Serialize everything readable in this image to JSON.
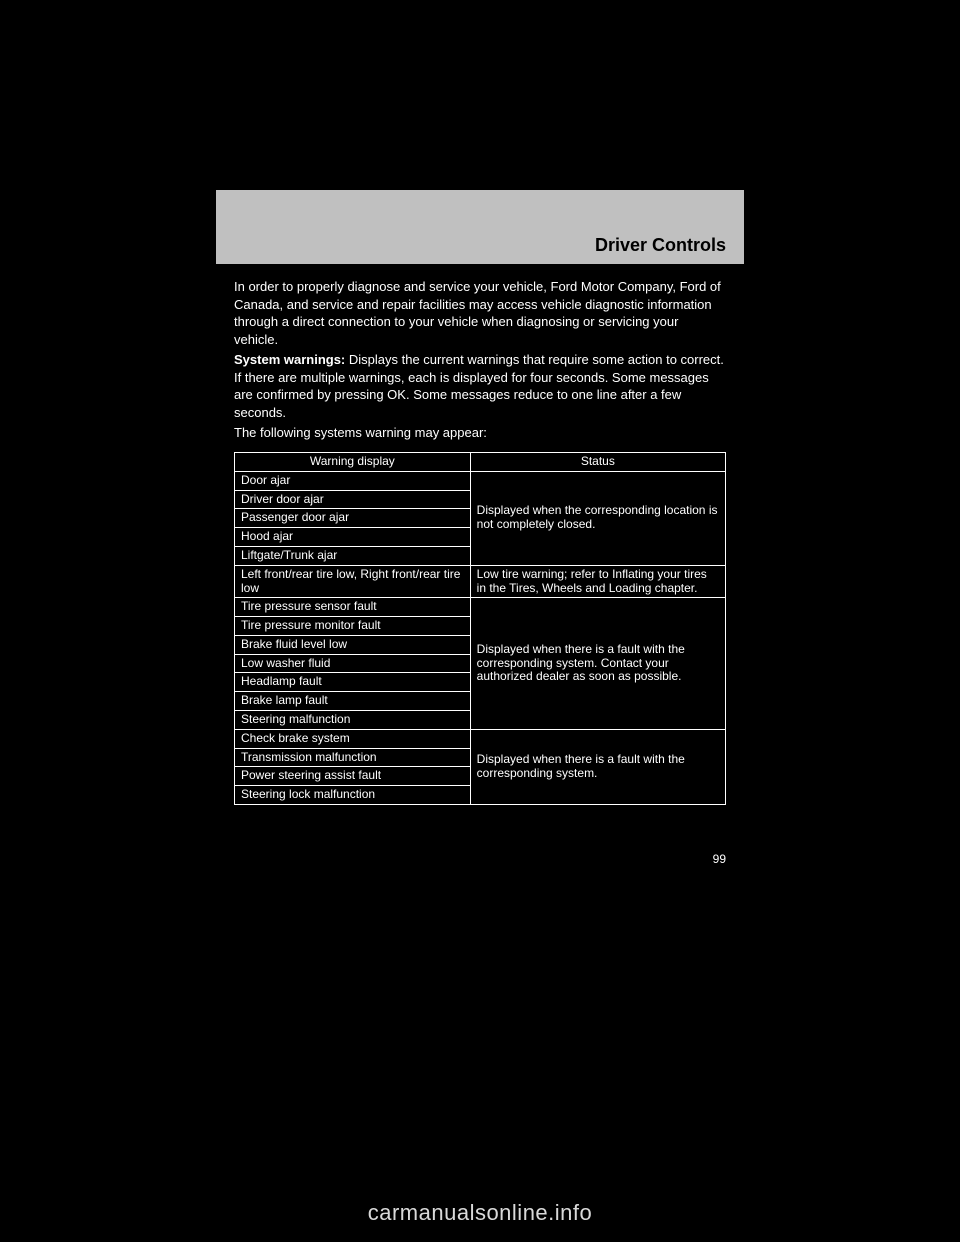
{
  "header": {
    "title": "Driver Controls"
  },
  "intro": {
    "p1": "In order to properly diagnose and service your vehicle, Ford Motor Company, Ford of Canada, and service and repair facilities may access vehicle diagnostic information through a direct connection to your vehicle when diagnosing or servicing your vehicle.",
    "p2_strong": "System warnings:",
    "p2_rest": " Displays the current warnings that require some action to correct. If there are multiple warnings, each is displayed for four seconds. Some messages are confirmed by pressing OK. Some messages reduce to one line after a few seconds.",
    "p3": "The following systems warning may appear:"
  },
  "table": {
    "head": {
      "a": "Warning display",
      "b": "Status"
    },
    "rows": [
      {
        "a": "Door ajar",
        "b": "",
        "rowspan_b": 5,
        "b_text": "Displayed when the corresponding location is not completely closed."
      },
      {
        "a": "Driver door ajar"
      },
      {
        "a": "Passenger door ajar"
      },
      {
        "a": "Hood ajar"
      },
      {
        "a": "Liftgate/Trunk ajar"
      },
      {
        "a": "Left front/rear tire low, Right front/rear tire low",
        "b": "Low tire warning; refer to Inflating your tires in the Tires, Wheels and Loading chapter."
      },
      {
        "a": "Tire pressure sensor fault",
        "b": "",
        "rowspan_b": 7,
        "b_text": "Displayed when there is a fault with the corresponding system. Contact your authorized dealer as soon as possible."
      },
      {
        "a": "Tire pressure monitor fault"
      },
      {
        "a": "Brake fluid level low"
      },
      {
        "a": "Low washer fluid"
      },
      {
        "a": "Headlamp fault"
      },
      {
        "a": "Brake lamp fault"
      },
      {
        "a": "Steering malfunction"
      },
      {
        "a": "Check brake system",
        "b": "",
        "rowspan_b": 4,
        "b_text": "Displayed when there is a fault with the corresponding system."
      },
      {
        "a": "Transmission malfunction"
      },
      {
        "a": "Power steering assist fault"
      },
      {
        "a": "Steering lock malfunction"
      }
    ]
  },
  "page_number": "99",
  "watermark": "carmanualsonline.info"
}
